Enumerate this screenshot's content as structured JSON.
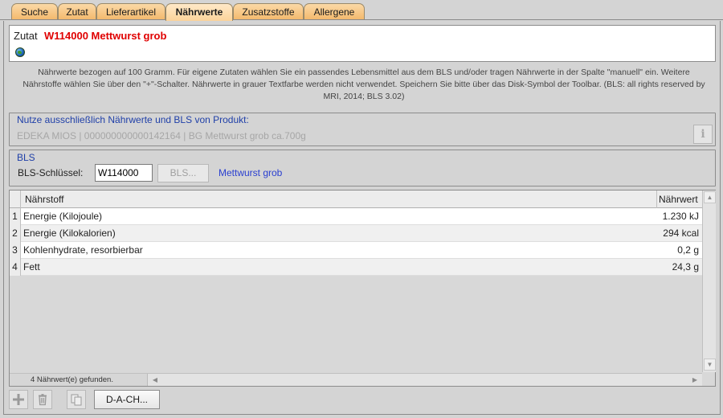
{
  "tabs": [
    {
      "label": "Suche",
      "active": false
    },
    {
      "label": "Zutat",
      "active": false
    },
    {
      "label": "Lieferartikel",
      "active": false
    },
    {
      "label": "Nährwerte",
      "active": true
    },
    {
      "label": "Zusatzstoffe",
      "active": false
    },
    {
      "label": "Allergene",
      "active": false
    }
  ],
  "zutat": {
    "label": "Zutat",
    "name": "W114000 Mettwurst grob",
    "icon": "globe-icon"
  },
  "info_text": "Nährwerte bezogen auf 100 Gramm. Für eigene Zutaten wählen Sie ein passendes Lebensmittel aus dem BLS und/oder tragen Nährwerte in der Spalte \"manuell\" ein. Weitere Nährstoffe wählen Sie über den \"+\"-Schalter. Nährwerte in grauer Textfarbe werden nicht verwendet. Speichern Sie bitte über das Disk-Symbol der Toolbar. (BLS: all rights reserved by MRI, 2014; BLS 3.02)",
  "produkt": {
    "legend": "Nutze ausschließlich Nährwerte und BLS von Produkt:",
    "value": "EDEKA MIOS | 000000000000142164 | BG Mettwurst grob ca.700g",
    "info_button": "i"
  },
  "bls": {
    "legend": "BLS",
    "key_label": "BLS-Schlüssel:",
    "key_value": "W114000",
    "button_label": "BLS...",
    "name": "Mettwurst grob"
  },
  "table": {
    "columns": {
      "naehrstoff": "Nährstoff",
      "naehrwert": "Nährwert"
    },
    "rows": [
      {
        "num": "1",
        "name": "Energie (Kilojoule)",
        "value": "1.230 kJ"
      },
      {
        "num": "2",
        "name": "Energie (Kilokalorien)",
        "value": "294 kcal"
      },
      {
        "num": "3",
        "name": "Kohlenhydrate, resorbierbar",
        "value": "0,2 g"
      },
      {
        "num": "4",
        "name": "Fett",
        "value": "24,3 g"
      }
    ],
    "status": "4  Nährwert(e) gefunden."
  },
  "toolbar": {
    "add_icon": "plus-icon",
    "delete_icon": "trash-icon",
    "copy_icon": "copy-icon",
    "dach_label": "D-A-CH..."
  },
  "colors": {
    "tab": "#f3b86a",
    "zutat_name": "#e00000",
    "legend": "#1f3fa8",
    "bls_name": "#2a3fd0"
  }
}
